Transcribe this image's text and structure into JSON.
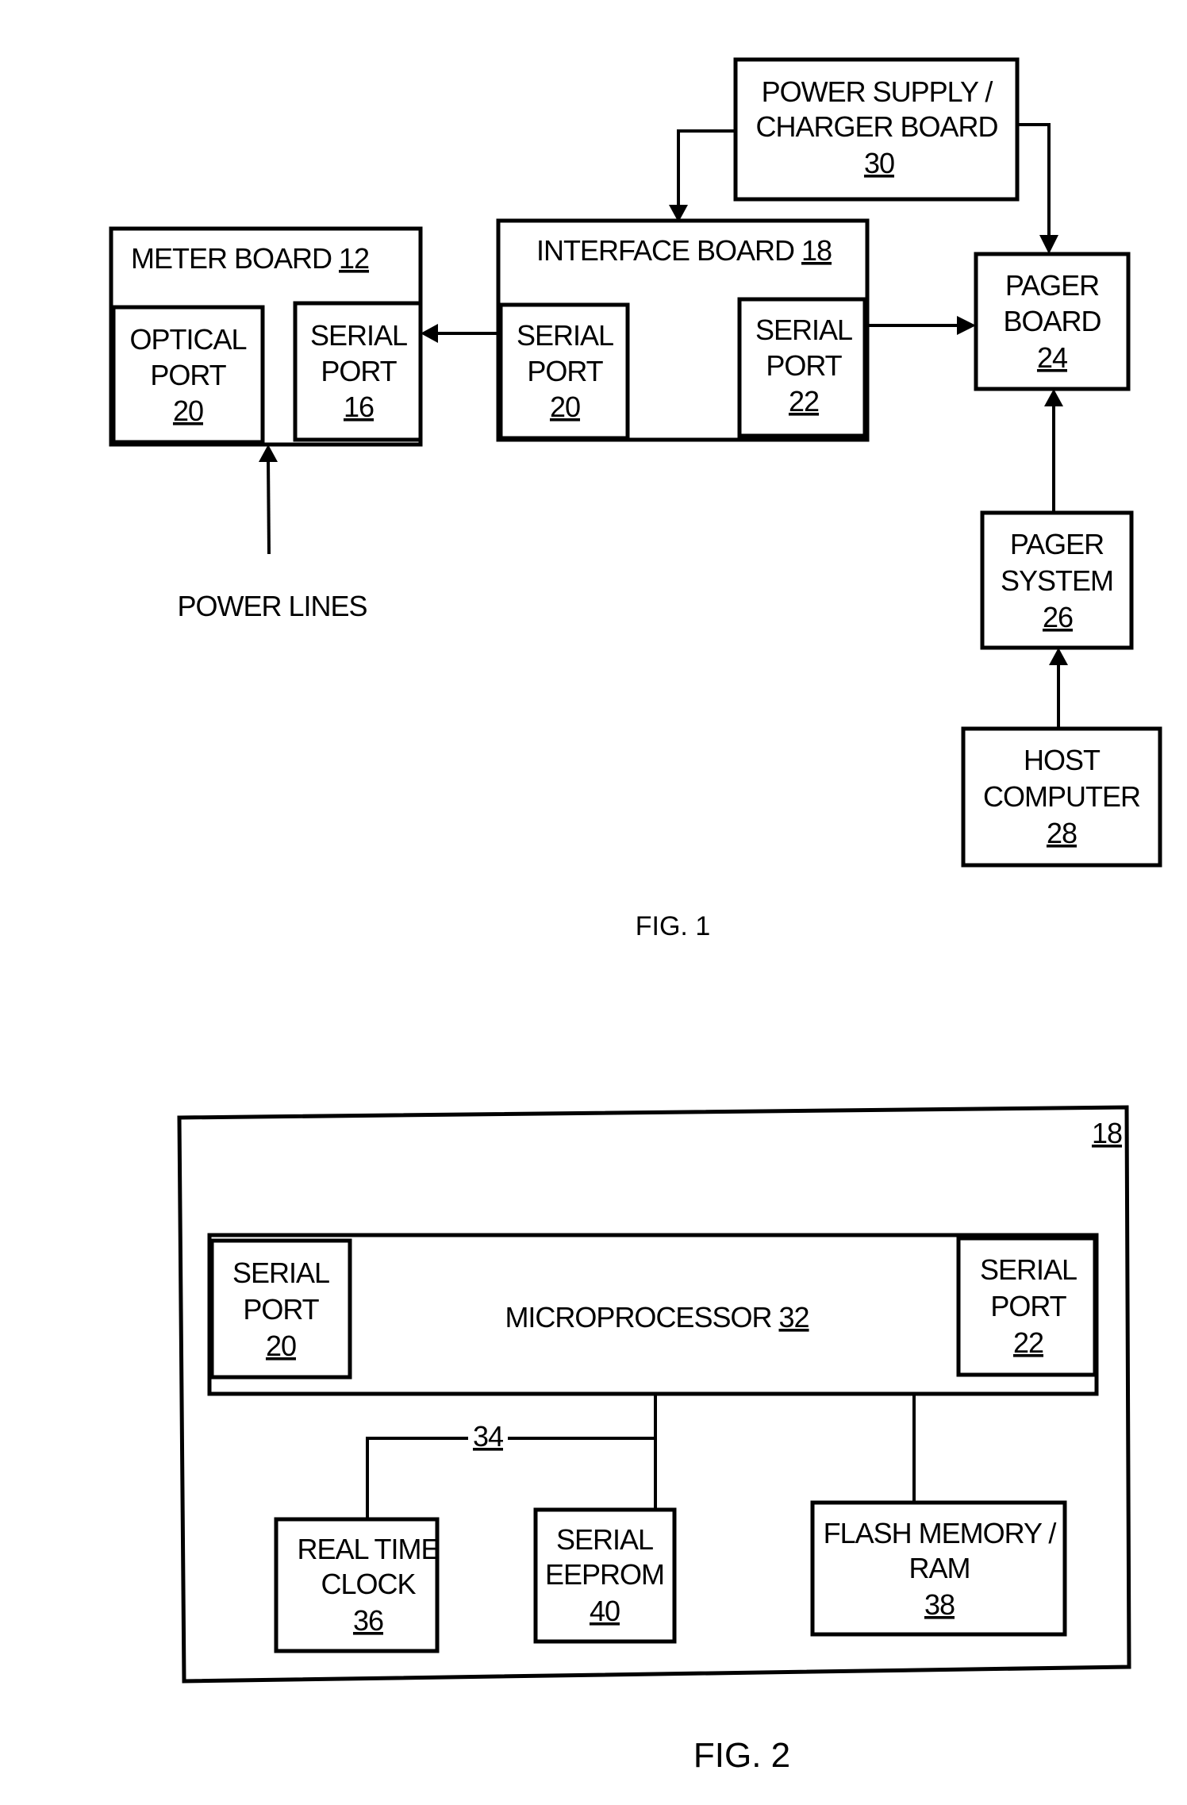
{
  "figures": [
    {
      "caption": "FIG. 1",
      "blocks": {
        "power_supply": {
          "line1": "POWER SUPPLY /",
          "line2": "CHARGER BOARD",
          "ref": "30"
        },
        "meter_board": {
          "title": "METER BOARD",
          "ref": "12",
          "optical_port": {
            "line1": "OPTICAL",
            "line2": "PORT",
            "ref": "20"
          },
          "serial_port": {
            "line1": "SERIAL",
            "line2": "PORT",
            "ref": "16"
          }
        },
        "interface_board": {
          "title": "INTERFACE BOARD",
          "ref": "18",
          "serial_port_left": {
            "line1": "SERIAL",
            "line2": "PORT",
            "ref": "20"
          },
          "serial_port_right": {
            "line1": "SERIAL",
            "line2": "PORT",
            "ref": "22"
          }
        },
        "pager_board": {
          "line1": "PAGER",
          "line2": "BOARD",
          "ref": "24"
        },
        "pager_system": {
          "line1": "PAGER",
          "line2": "SYSTEM",
          "ref": "26"
        },
        "host_computer": {
          "line1": "HOST",
          "line2": "COMPUTER",
          "ref": "28"
        },
        "power_lines": {
          "label": "POWER LINES"
        }
      },
      "connections": [
        {
          "from": "power_supply",
          "to": "interface_board"
        },
        {
          "from": "power_supply",
          "to": "pager_board"
        },
        {
          "from": "interface_board.serial_port_left",
          "to": "meter_board.serial_port"
        },
        {
          "from": "interface_board.serial_port_right",
          "to": "pager_board"
        },
        {
          "from": "pager_system",
          "to": "pager_board"
        },
        {
          "from": "host_computer",
          "to": "pager_system"
        },
        {
          "from": "power_lines",
          "to": "meter_board"
        }
      ]
    },
    {
      "caption": "FIG. 2",
      "container_ref": "18",
      "blocks": {
        "microprocessor": {
          "title": "MICROPROCESSOR",
          "ref": "32",
          "serial_port_left": {
            "line1": "SERIAL",
            "line2": "PORT",
            "ref": "20"
          },
          "serial_port_right": {
            "line1": "SERIAL",
            "line2": "PORT",
            "ref": "22"
          }
        },
        "bus": {
          "ref": "34"
        },
        "real_time_clock": {
          "line1": "REAL TIME",
          "line2": "CLOCK",
          "ref": "36"
        },
        "serial_eeprom": {
          "line1": "SERIAL",
          "line2": "EEPROM",
          "ref": "40"
        },
        "flash_memory": {
          "line1": "FLASH MEMORY /",
          "line2": "RAM",
          "ref": "38"
        }
      },
      "connections": [
        {
          "from": "microprocessor",
          "to": "real_time_clock",
          "via": "bus"
        },
        {
          "from": "microprocessor",
          "to": "serial_eeprom"
        },
        {
          "from": "microprocessor",
          "to": "flash_memory"
        }
      ]
    }
  ]
}
